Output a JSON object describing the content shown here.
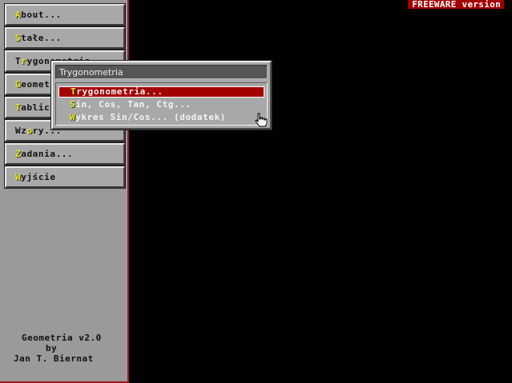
{
  "badge": {
    "text": "FREEWARE version"
  },
  "sidebar": {
    "items": [
      {
        "hotkey": "A",
        "rest": "bout..."
      },
      {
        "hotkey": "S",
        "rest": "tałe..."
      },
      {
        "pre": "T",
        "hotkey": "r",
        "rest": "ygonometria"
      },
      {
        "hotkey": "G",
        "rest": "eometria"
      },
      {
        "hotkey": "T",
        "rest": "ablice"
      },
      {
        "pre": "Wz",
        "hotkey": "o",
        "rest": "ry..."
      },
      {
        "hotkey": "Z",
        "rest": "adania..."
      },
      {
        "hotkey": "W",
        "rest": "yjście"
      }
    ]
  },
  "credits": {
    "line1": "Geometria v2.0",
    "line2": "by",
    "line3": "Jan T. Biernat"
  },
  "dialog": {
    "title": "Trygonometria",
    "options": [
      {
        "hotkey": "T",
        "rest": "rygonometria...",
        "selected": true
      },
      {
        "hotkey": "S",
        "rest": "in, Cos, Tan, Ctg...",
        "selected": false
      },
      {
        "hotkey": "W",
        "rest": "ykres Sin/Cos... (dodatek)",
        "selected": false
      }
    ]
  },
  "colors": {
    "desktop": "#000000",
    "panel": "#9a9a9a",
    "button": "#a8a8a8",
    "selection": "#a40000",
    "hotkey": "#e8e830",
    "title_bar": "#555555"
  },
  "icons": {
    "pointer": "hand-pointer-icon"
  }
}
